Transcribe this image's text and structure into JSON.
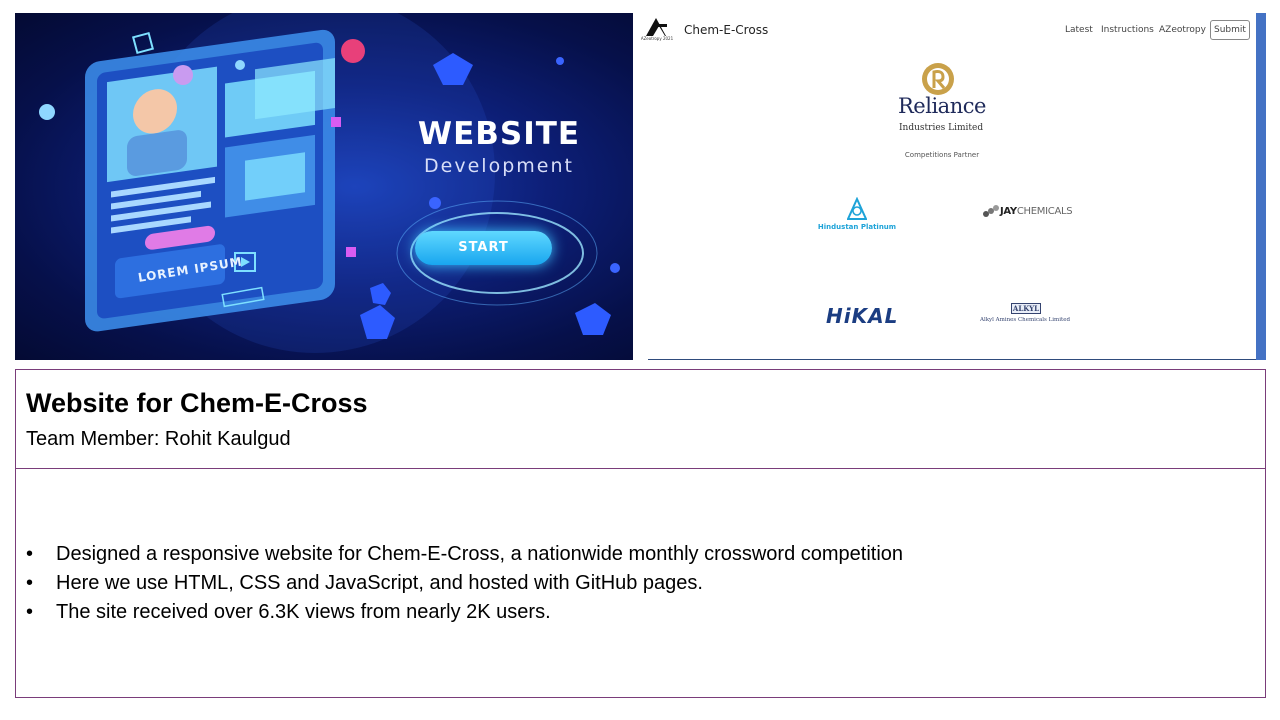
{
  "slide": {
    "title": "Website for Chem-E-Cross",
    "team_member": "Team Member: Rohit Kaulgud",
    "bullets": [
      "Designed a responsive website for Chem-E-Cross, a nationwide monthly crossword competition",
      "Here we use HTML, CSS and JavaScript, and hosted with GitHub pages.",
      "The site received over 6.3K views from nearly 2K users."
    ],
    "bullet_glyph": "•",
    "border_color": "#7a3d7a"
  },
  "illustration": {
    "headline": "WEBSITE",
    "subline": "Development",
    "start_label": "START",
    "lorem": "LOREM IPSUM"
  },
  "site_screenshot": {
    "logo_caption": "AZeotropy 2021",
    "brand": "Chem-E-Cross",
    "nav": [
      "Latest",
      "Instructions",
      "AZeotropy"
    ],
    "submit_label": "Submit",
    "main_sponsor": {
      "name": "Reliance",
      "subtitle": "Industries Limited"
    },
    "partner_caption": "Competitions Partner",
    "sponsors": {
      "hindustan_platinum": "Hindustan Platinum",
      "jay_chemicals_bold": "JAY",
      "jay_chemicals_rest": "CHEMICALS",
      "hikal": "HiKAL",
      "alkyl_badge": "ALKYL",
      "alkyl_name": "Alkyl Amines Chemicals Limited"
    },
    "accent_color": "#4472c4"
  }
}
